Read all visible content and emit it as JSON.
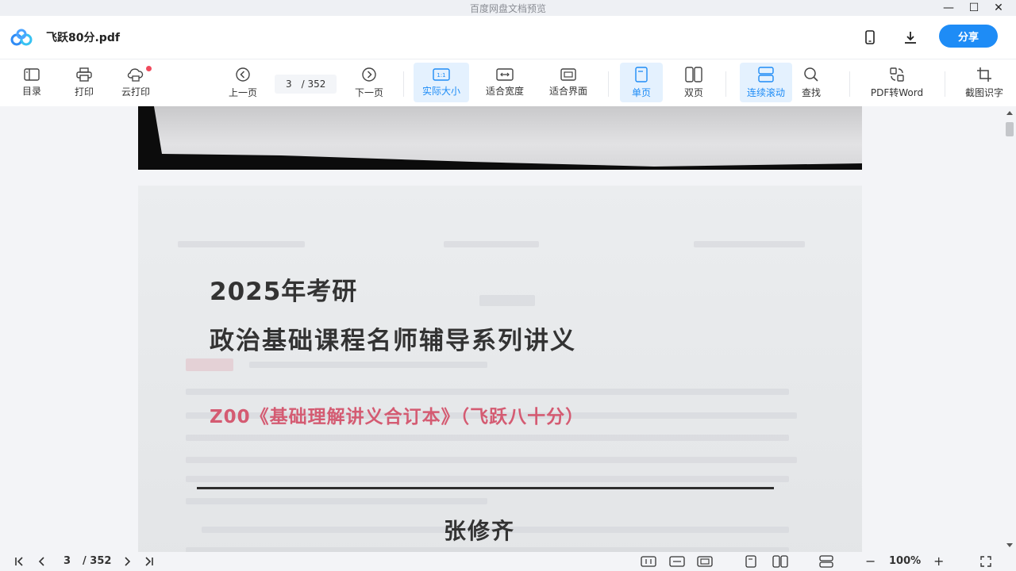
{
  "window": {
    "title": "百度网盘文档预览",
    "minimize": "—",
    "maximize": "☐",
    "close": "✕"
  },
  "header": {
    "filename": "飞跃80分.pdf",
    "share_label": "分享"
  },
  "toolbar": {
    "toc": "目录",
    "print": "打印",
    "cloud_print": "云打印",
    "prev_page": "上一页",
    "current_page": "3",
    "page_separator": "/ 352",
    "next_page": "下一页",
    "actual_size": "实际大小",
    "actual_size_badge": "1:1",
    "fit_width": "适合宽度",
    "fit_screen": "适合界面",
    "single_page": "单页",
    "double_page": "双页",
    "continuous_scroll": "连续滚动",
    "find": "查找",
    "pdf_to_word": "PDF转Word",
    "ocr": "截图识字"
  },
  "document": {
    "line1": "2025年考研",
    "line2": "政治基础课程名师辅导系列讲义",
    "line3": "Z00《基础理解讲义合订本》（飞跃八十分）",
    "author": "张修齐"
  },
  "statusbar": {
    "current_page": "3",
    "total_pages": "/ 352",
    "zoom": "100%",
    "zoom_minus": "−",
    "zoom_plus": "+"
  },
  "colors": {
    "accent": "#1e8cf6",
    "active_bg": "#e4f1fe",
    "notification_dot": "#f04a5d",
    "doc_red": "#d45b72"
  }
}
